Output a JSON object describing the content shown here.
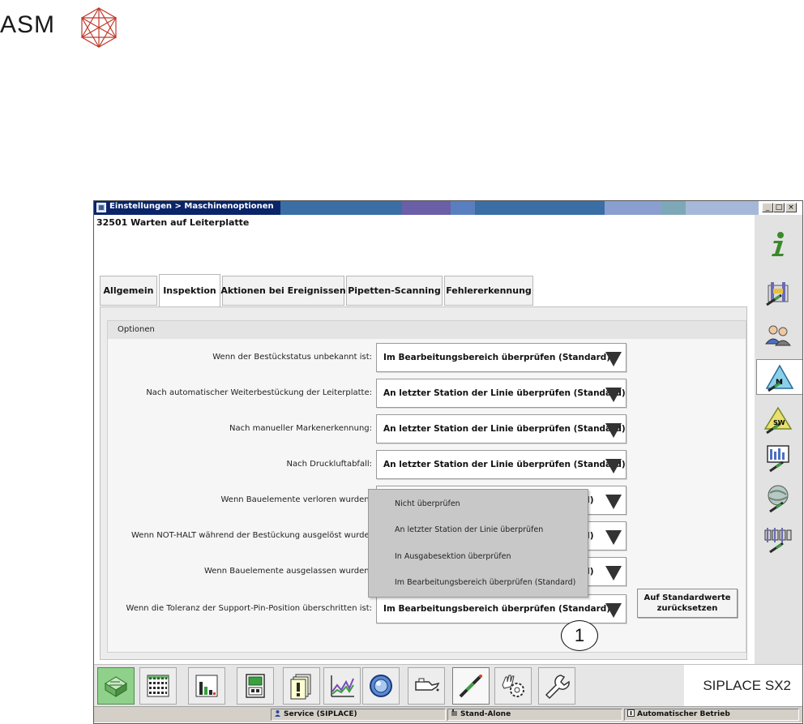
{
  "logo": {
    "text": "ASM"
  },
  "window": {
    "title": "Einstellungen > Maschinenoptionen",
    "controls": {
      "minimize": "_",
      "maximize": "□",
      "close": "×"
    },
    "status_message": "32501 Warten auf Leiterplatte"
  },
  "tabs": [
    {
      "label": "Allgemein",
      "active": false
    },
    {
      "label": "Inspektion",
      "active": true
    },
    {
      "label": "Aktionen bei Ereignissen",
      "active": false
    },
    {
      "label": "Pipetten-Scanning",
      "active": false
    },
    {
      "label": "Fehlererkennung",
      "active": false
    }
  ],
  "group": {
    "title": "Optionen",
    "rows": [
      {
        "label": "Wenn der Bestückstatus unbekannt ist:",
        "value": "Im Bearbeitungsbereich überprüfen (Standard)"
      },
      {
        "label": "Nach automatischer Weiterbestückung der Leiterplatte:",
        "value": "An letzter Station der Linie überprüfen (Standard)"
      },
      {
        "label": "Nach manueller Markenerkennung:",
        "value": "An letzter Station der Linie überprüfen (Standard)"
      },
      {
        "label": "Nach Druckluftabfall:",
        "value": "An letzter Station der Linie überprüfen (Standard)"
      },
      {
        "label": "Wenn Bauelemente verloren wurden:",
        "value": "rd)"
      },
      {
        "label": "Wenn NOT-HALT während der Bestückung ausgelöst wurde:",
        "value": "rd)"
      },
      {
        "label": "Wenn Bauelemente ausgelassen wurden:",
        "value": "rd)"
      },
      {
        "label": "Wenn die Toleranz der Support-Pin-Position überschritten ist:",
        "value": "Im Bearbeitungsbereich überprüfen (Standard)"
      }
    ],
    "popup_options": [
      "Nicht überprüfen",
      "An letzter Station der Linie überprüfen",
      "In Ausgabesektion überprüfen",
      "Im Bearbeitungsbereich überprüfen (Standard)"
    ],
    "reset_button": "Auf Standardwerte zurücksetzen"
  },
  "callout": "1",
  "right_toolbar": [
    {
      "icon": "info-icon",
      "active": false
    },
    {
      "icon": "machine-config-icon",
      "active": false
    },
    {
      "icon": "users-icon",
      "active": false
    },
    {
      "icon": "machine-options-icon",
      "active": true
    },
    {
      "icon": "software-icon",
      "active": false
    },
    {
      "icon": "monitor-icon",
      "active": false
    },
    {
      "icon": "network-icon",
      "active": false
    },
    {
      "icon": "line-config-icon",
      "active": false
    }
  ],
  "bottom_toolbar": [
    {
      "icon": "production-icon",
      "state": "active"
    },
    {
      "icon": "setup-grid-icon",
      "state": "normal"
    },
    {
      "icon": "statistics-icon",
      "state": "normal"
    },
    {
      "icon": "feeder-icon",
      "state": "normal"
    },
    {
      "icon": "messages-icon",
      "state": "normal"
    },
    {
      "icon": "trend-chart-icon",
      "state": "normal"
    },
    {
      "icon": "camera-icon",
      "state": "normal"
    },
    {
      "icon": "oil-can-icon",
      "state": "normal"
    },
    {
      "icon": "nozzle-icon",
      "state": "pressed"
    },
    {
      "icon": "hand-gear-icon",
      "state": "normal"
    },
    {
      "icon": "wrench-icon",
      "state": "normal"
    }
  ],
  "product_name": "SIPLACE SX2",
  "statusbar": {
    "user": "Service (SIPLACE)",
    "mode": "Stand-Alone",
    "operation": "Automatischer Betrieb"
  },
  "colors": {
    "title_bar": "#0a246a",
    "active_bottom_button": "#8fd08a",
    "info_icon": "#3a8a2a"
  }
}
